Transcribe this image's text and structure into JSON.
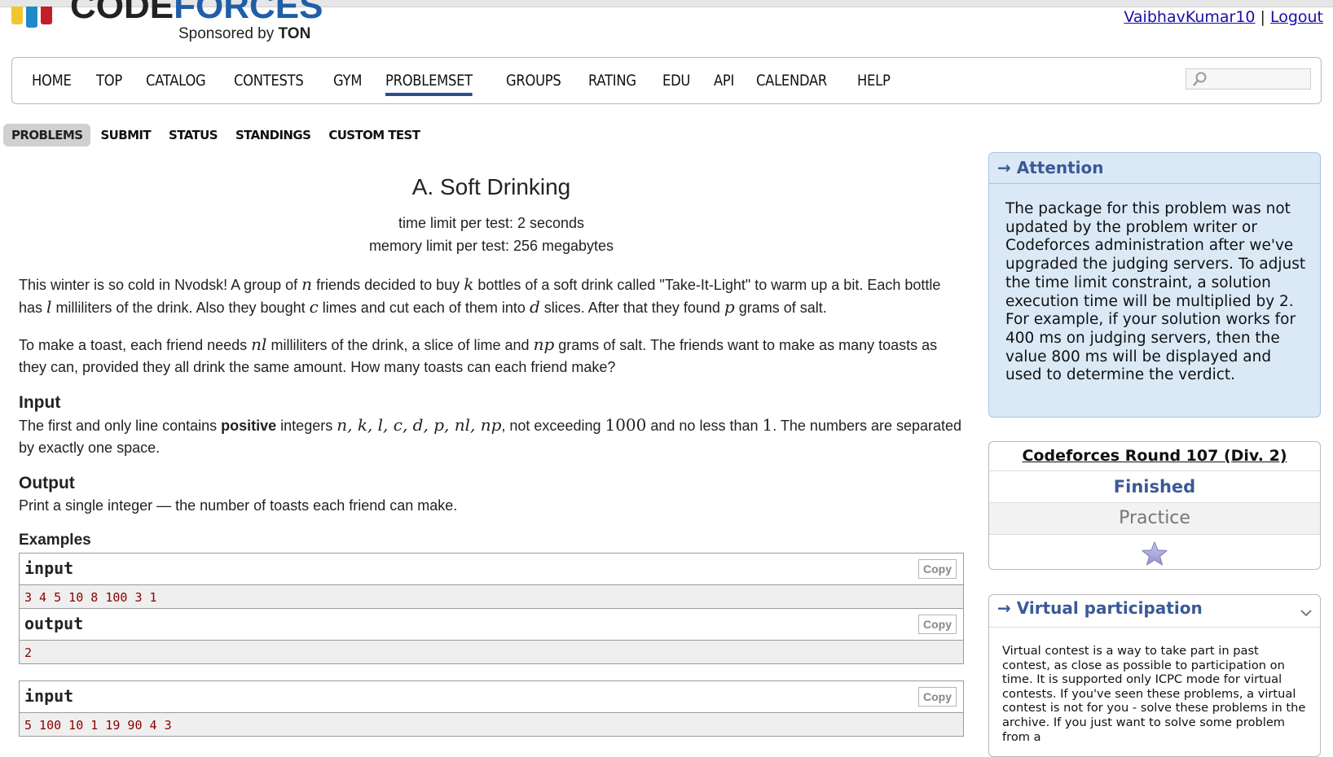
{
  "header": {
    "logo_code": "CODE",
    "logo_forces": "FORCES",
    "sponsor_prefix": "Sponsored by",
    "sponsor_name": "TON",
    "username": "VaibhavKumar10",
    "separator": "|",
    "logout": "Logout"
  },
  "menu": {
    "items": [
      "HOME",
      "TOP",
      "CATALOG",
      "CONTESTS",
      "GYM",
      "PROBLEMSET",
      "GROUPS",
      "RATING",
      "EDU",
      "API",
      "CALENDAR",
      "HELP"
    ],
    "active": "PROBLEMSET",
    "search_icon": "search-icon"
  },
  "submenu": {
    "items": [
      "PROBLEMS",
      "SUBMIT",
      "STATUS",
      "STANDINGS",
      "CUSTOM TEST"
    ],
    "active": "PROBLEMS"
  },
  "problem": {
    "title": "A. Soft Drinking",
    "time_limit": "time limit per test: 2 seconds",
    "memory_limit": "memory limit per test: 256 megabytes",
    "legend": {
      "t1": "This winter is so cold in Nvodsk! A group of ",
      "v_n": "n",
      "t2": " friends decided to buy ",
      "v_k": "k",
      "t3": " bottles of a soft drink called \"Take-It-Light\" to warm up a bit. Each bottle has ",
      "v_l": "l",
      "t4": " milliliters of the drink. Also they bought ",
      "v_c": "c",
      "t5": " limes and cut each of them into ",
      "v_d": "d",
      "t6": " slices. After that they found ",
      "v_p": "p",
      "t7": " grams of salt."
    },
    "legend2": {
      "t1": "To make a toast, each friend needs ",
      "v_nl": "nl",
      "t2": " milliliters of the drink, a slice of lime and ",
      "v_np": "np",
      "t3": " grams of salt. The friends want to make as many toasts as they can, provided they all drink the same amount. How many toasts can each friend make?"
    },
    "input_title": "Input",
    "input_spec": {
      "t1": "The first and only line contains ",
      "bold": "positive",
      "t2": " integers ",
      "vars": "n, k, l, c, d, p, nl, np",
      "t3": ", not exceeding ",
      "v_max": "1000",
      "t4": " and no less than ",
      "v_min": "1",
      "t5": ". The numbers are separated by exactly one space."
    },
    "output_title": "Output",
    "output_spec": "Print a single integer — the number of toasts each friend can make.",
    "examples_title": "Examples",
    "copy_label": "Copy",
    "samples": [
      {
        "label": "input",
        "text": "3 4 5 10 8 100 3 1"
      },
      {
        "label": "output",
        "text": "2"
      },
      {
        "label": "input",
        "text": "5 100 10 1 19 90 4 3"
      }
    ]
  },
  "sidebar": {
    "attention_title": "→ Attention",
    "attention_text": "The package for this problem was not updated by the problem writer or Codeforces administration after we've upgraded the judging servers. To adjust the time limit constraint, a solution execution time will be multiplied by 2. For example, if your solution works for 400 ms on judging servers, then the value 800 ms will be displayed and used to determine the verdict.",
    "round_name": "Codeforces Round 107 (Div. 2)",
    "round_status": "Finished",
    "round_mode": "Practice",
    "virtual_title": "→ Virtual participation",
    "virtual_text": "Virtual contest is a way to take part in past contest, as close as possible to participation on time. It is supported only ICPC mode for virtual contests. If you've seen these problems, a virtual contest is not for you - solve these problems in the archive. If you just want to solve some problem from a"
  },
  "colors": {
    "logo_yellow": "#f3c630",
    "logo_blue": "#1f8acb",
    "logo_red": "#c41e2a",
    "accent_blue": "#3b5998",
    "attention_bg": "#dbe9f7"
  }
}
